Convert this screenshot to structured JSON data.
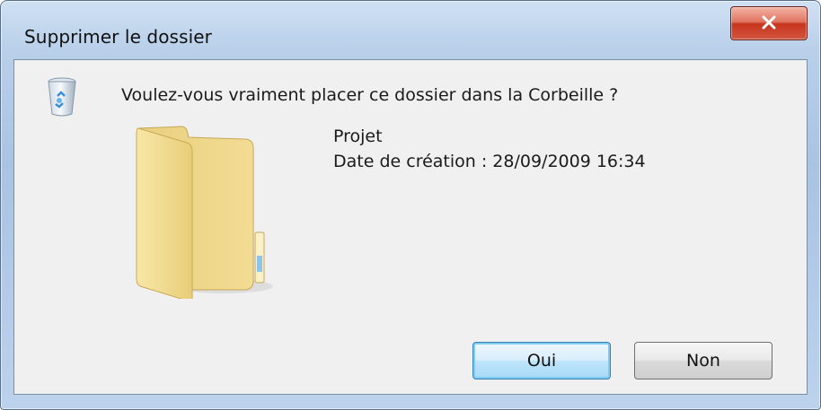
{
  "window": {
    "title": "Supprimer le dossier",
    "close_icon": "close-x-icon"
  },
  "dialog": {
    "question": "Voulez-vous vraiment placer ce dossier dans la Corbeille ?",
    "icon": "recycle-bin-icon",
    "item": {
      "icon": "folder-icon",
      "name": "Projet",
      "created": "Date de création : 28/09/2009 16:34"
    }
  },
  "buttons": {
    "yes_label": "Oui",
    "no_label": "Non"
  },
  "colors": {
    "frame": "#b9d0ea",
    "close_button": "#c8341e",
    "default_button_border": "#3c7fb1",
    "client_bg": "#f0f0f0"
  }
}
